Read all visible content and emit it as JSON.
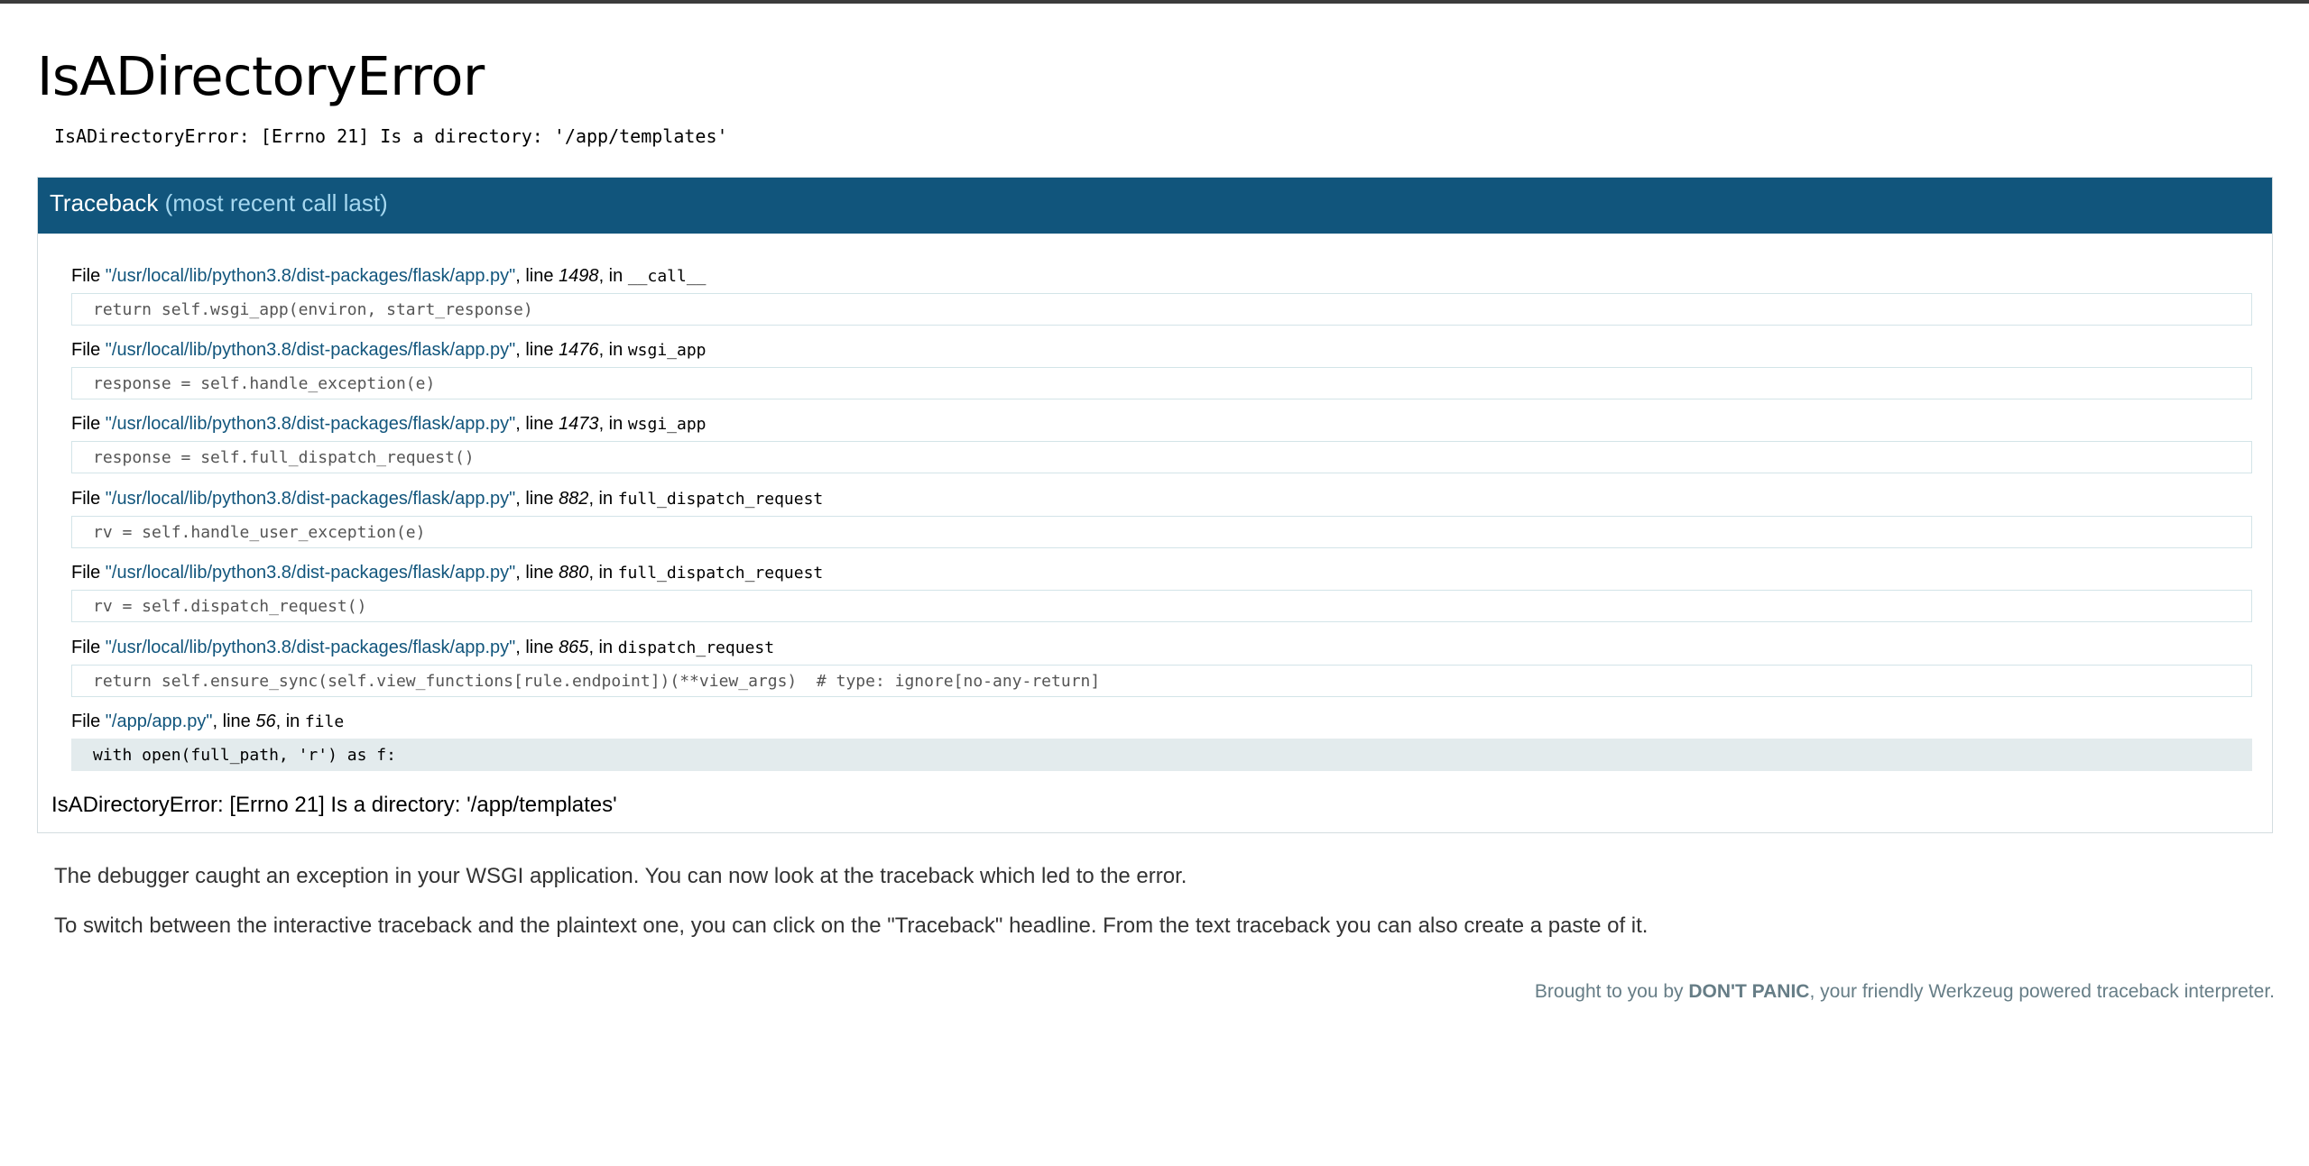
{
  "error": {
    "title": "IsADirectoryError",
    "message": "IsADirectoryError: [Errno 21] Is a directory: '/app/templates'"
  },
  "traceback": {
    "header_label": "Traceback",
    "header_sub": "(most recent call last)",
    "frames": [
      {
        "file_prefix": "File ",
        "filename": "\"/usr/local/lib/python3.8/dist-packages/flask/app.py\"",
        "line_prefix": ", line ",
        "line": "1498",
        "in_prefix": ", in ",
        "function": "__call__",
        "code": "return self.wsgi_app(environ, start_response)"
      },
      {
        "file_prefix": "File ",
        "filename": "\"/usr/local/lib/python3.8/dist-packages/flask/app.py\"",
        "line_prefix": ", line ",
        "line": "1476",
        "in_prefix": ", in ",
        "function": "wsgi_app",
        "code": "response = self.handle_exception(e)"
      },
      {
        "file_prefix": "File ",
        "filename": "\"/usr/local/lib/python3.8/dist-packages/flask/app.py\"",
        "line_prefix": ", line ",
        "line": "1473",
        "in_prefix": ", in ",
        "function": "wsgi_app",
        "code": "response = self.full_dispatch_request()"
      },
      {
        "file_prefix": "File ",
        "filename": "\"/usr/local/lib/python3.8/dist-packages/flask/app.py\"",
        "line_prefix": ", line ",
        "line": "882",
        "in_prefix": ", in ",
        "function": "full_dispatch_request",
        "code": "rv = self.handle_user_exception(e)"
      },
      {
        "file_prefix": "File ",
        "filename": "\"/usr/local/lib/python3.8/dist-packages/flask/app.py\"",
        "line_prefix": ", line ",
        "line": "880",
        "in_prefix": ", in ",
        "function": "full_dispatch_request",
        "code": "rv = self.dispatch_request()"
      },
      {
        "file_prefix": "File ",
        "filename": "\"/usr/local/lib/python3.8/dist-packages/flask/app.py\"",
        "line_prefix": ", line ",
        "line": "865",
        "in_prefix": ", in ",
        "function": "dispatch_request",
        "code": "return self.ensure_sync(self.view_functions[rule.endpoint])(**view_args)  # type: ignore[no-any-return]"
      },
      {
        "file_prefix": "File ",
        "filename": "\"/app/app.py\"",
        "line_prefix": ", line ",
        "line": "56",
        "in_prefix": ", in ",
        "function": "file",
        "code": "with open(full_path, 'r') as f:"
      }
    ],
    "exception_line": "IsADirectoryError: [Errno 21] Is a directory: '/app/templates'"
  },
  "explanation": {
    "p1": "The debugger caught an exception in your WSGI application. You can now look at the traceback which led to the error.",
    "p2": "To switch between the interactive traceback and the plaintext one, you can click on the \"Traceback\" headline. From the text traceback you can also create a paste of it."
  },
  "footer": {
    "prefix": "Brought to you by ",
    "brand": "DON'T PANIC",
    "suffix": ", your friendly Werkzeug powered traceback interpreter."
  },
  "colors": {
    "header_bg": "#11557c",
    "header_sub": "#a6d8f0",
    "filename": "#11557c",
    "footer_text": "#667d86"
  }
}
